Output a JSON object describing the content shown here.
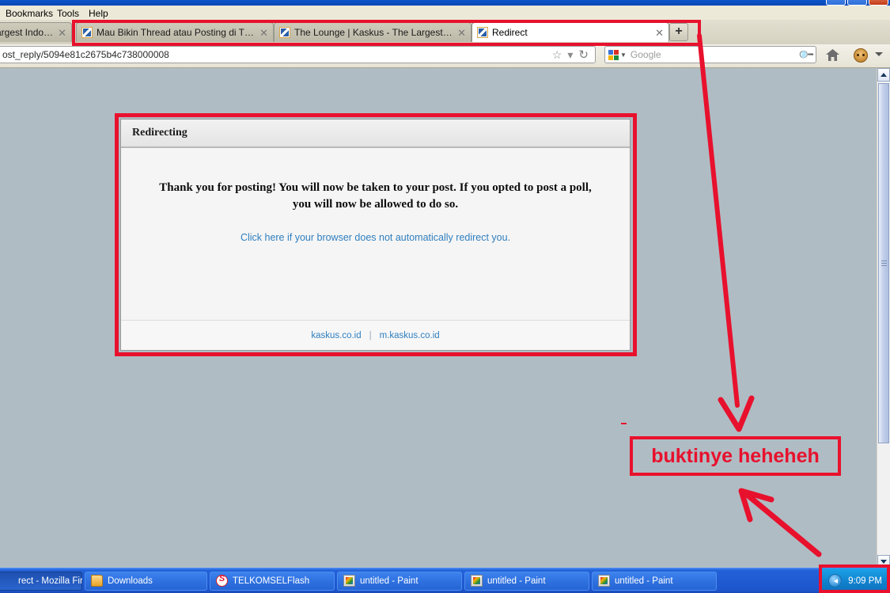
{
  "window": {
    "controls": [
      "minimize",
      "maximize",
      "close"
    ]
  },
  "menubar": {
    "items": [
      {
        "label": "Bookmarks",
        "accel": "B"
      },
      {
        "label": "Tools",
        "accel": "T"
      },
      {
        "label": "Help",
        "accel": "H"
      }
    ]
  },
  "tabs": [
    {
      "label": "argest Indon...",
      "active": false,
      "closable": true
    },
    {
      "label": "Mau Bikin Thread atau Posting di The Lou...",
      "active": false,
      "closable": true
    },
    {
      "label": "The Lounge | Kaskus - The Largest Indon...",
      "active": false,
      "closable": true
    },
    {
      "label": "Redirect",
      "active": true,
      "closable": true
    }
  ],
  "newtab": {
    "label": "+"
  },
  "navbar": {
    "url": "ost_reply/5094e81c2675b4c738000008",
    "bookmark_icon": "star-icon",
    "dropdown_icon": "chevron-down-icon",
    "reload_icon": "reload-icon",
    "search_engine": "Google",
    "search_value": "",
    "search_icon": "magnifier-icon",
    "home_icon": "home-icon",
    "addon_icon": "monkey-icon",
    "overflow_icon": "chevron-down-icon"
  },
  "page": {
    "panel_title": "Redirecting",
    "message": "Thank you for posting! You will now be taken to your post. If you opted to post a poll, you will now be allowed to do so.",
    "redirect_link": "Click here if your browser does not automatically redirect you.",
    "footer_links": [
      "kaskus.co.id",
      "m.kaskus.co.id"
    ],
    "footer_separator": "|"
  },
  "annotations": {
    "text": "buktinye heheheh",
    "color": "#e8112d",
    "boxes": [
      "tab-bar-highlight",
      "page-panel-highlight",
      "clock-highlight",
      "text-callout"
    ],
    "arrows": [
      "tab-to-text-arrow",
      "clock-to-text-arrow"
    ]
  },
  "scrollbar": {
    "up_icon": "scroll-up-icon",
    "down_icon": "scroll-down-icon"
  },
  "taskbar": {
    "buttons": [
      {
        "label": "rect - Mozilla Fire...",
        "icon": "firefox-icon",
        "active": true
      },
      {
        "label": "Downloads",
        "icon": "folder-icon",
        "active": false
      },
      {
        "label": "TELKOMSELFlash",
        "icon": "flash-icon",
        "active": false
      },
      {
        "label": "untitled - Paint",
        "icon": "paint-icon",
        "active": false
      },
      {
        "label": "untitled - Paint",
        "icon": "paint-icon",
        "active": false
      },
      {
        "label": "untitled - Paint",
        "icon": "paint-icon",
        "active": false
      }
    ],
    "tray": {
      "chevron_icon": "tray-expand-icon",
      "clock": "9:09 PM"
    }
  }
}
